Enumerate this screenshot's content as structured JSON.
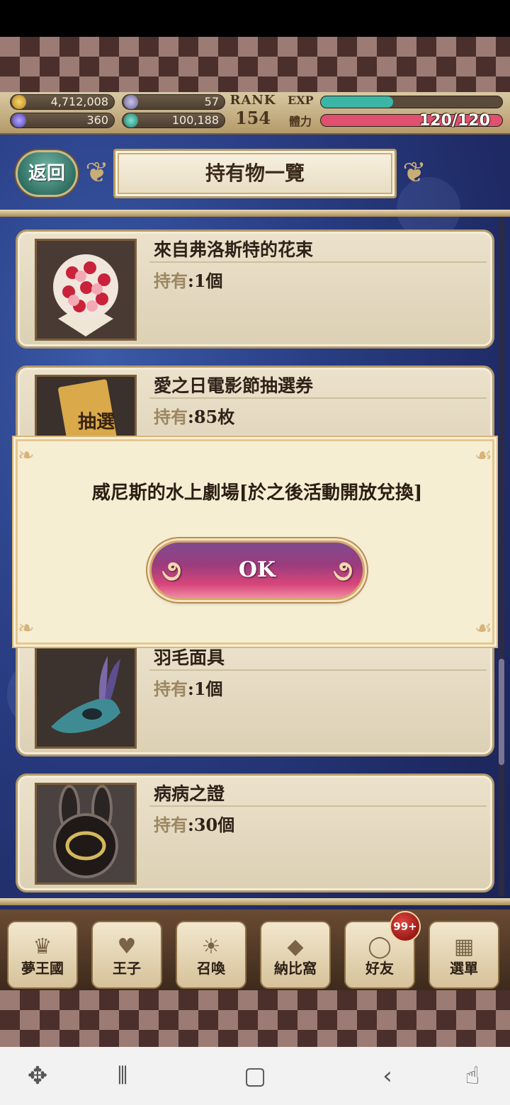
{
  "header": {
    "gold": "4,712,008",
    "tickets": "57",
    "gems": "360",
    "orbs": "100,188",
    "rank_label": "RANK",
    "rank_value": "154",
    "exp_label": "EXP",
    "exp_progress": 0.4,
    "stamina_label": "體力",
    "stamina_value": "120/120",
    "stamina_progress": 1.0,
    "colors": {
      "exp": "#3bb5a6",
      "stamina": "#e0506f"
    }
  },
  "nav": {
    "back_label": "返回",
    "title": "持有物一覽"
  },
  "items": [
    {
      "name": "來自弗洛斯特的花束",
      "qty_label": "持有",
      "qty_value": ":1個",
      "thumb": "bouquet-icon"
    },
    {
      "name": "愛之日電影節抽選券",
      "qty_label": "持有",
      "qty_value": ":85枚",
      "thumb": "lottery-ticket-icon",
      "thumb_text": "抽選"
    },
    {
      "name": "羽毛面具",
      "qty_label": "持有",
      "qty_value": ":1個",
      "thumb": "feather-mask-icon"
    },
    {
      "name": "病病之證",
      "qty_label": "持有",
      "qty_value": ":30個",
      "thumb": "bunny-emblem-icon"
    }
  ],
  "modal": {
    "message": "威尼斯的水上劇場[於之後活動開放兌換]",
    "ok_label": "OK"
  },
  "bottom_nav": [
    {
      "label": "夢王國",
      "icon": "crown-icon"
    },
    {
      "label": "王子",
      "icon": "heart-icon"
    },
    {
      "label": "召喚",
      "icon": "sun-icon"
    },
    {
      "label": "納比窩",
      "icon": "crystal-icon"
    },
    {
      "label": "好友",
      "icon": "ring-icon"
    },
    {
      "label": "選單",
      "icon": "grid-icon"
    }
  ],
  "friend_badge": "99+",
  "android_nav": {
    "home_icon": "home-icon",
    "recents_icon": "recents-icon",
    "back_icon": "back-icon"
  }
}
